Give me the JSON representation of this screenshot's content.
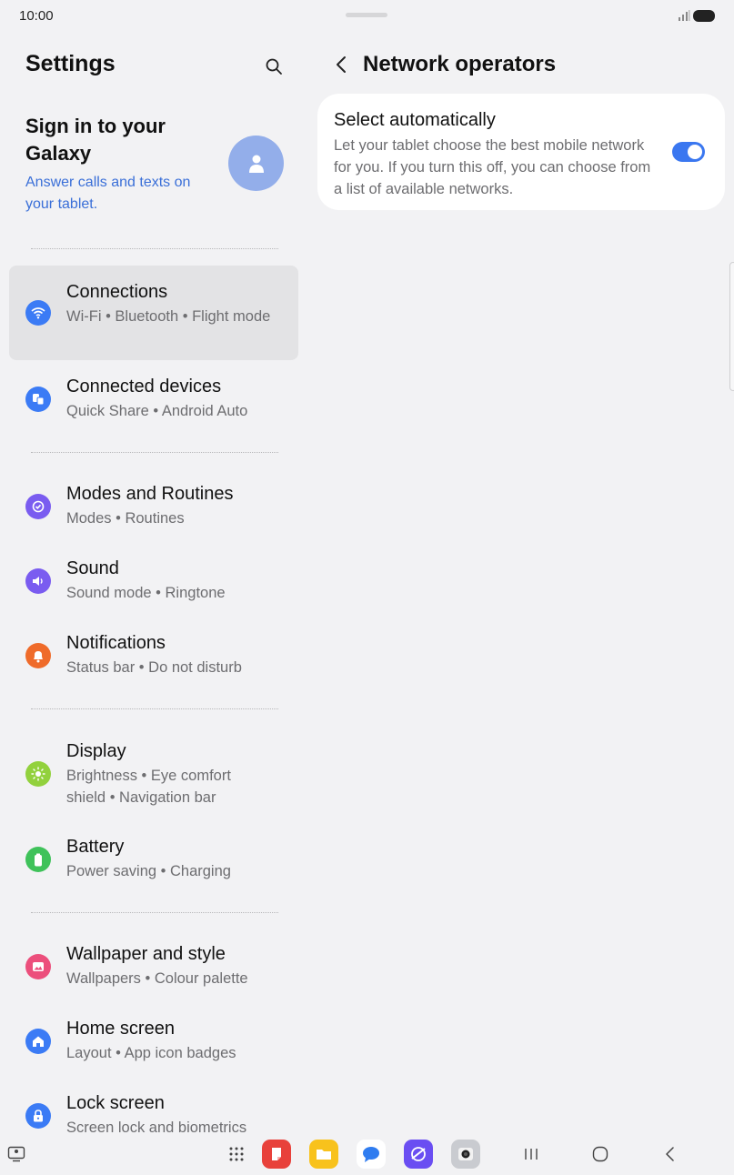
{
  "status_bar": {
    "time": "10:00",
    "icons": [
      "signal-icon",
      "battery-icon"
    ]
  },
  "settings": {
    "title": "Settings",
    "signin": {
      "title": "Sign in to your Galaxy",
      "subtitle": "Answer calls and texts on your tablet."
    },
    "items": [
      {
        "title": "Connections",
        "subtitle": "Wi-Fi  •  Bluetooth  •  Flight mode",
        "icon": "wifi-icon",
        "color": "#3b7bf5",
        "active": true
      },
      {
        "title": "Connected devices",
        "subtitle": "Quick Share  •  Android Auto",
        "icon": "devices-icon",
        "color": "#3b7bf5"
      },
      {
        "title": "Modes and Routines",
        "subtitle": "Modes  •  Routines",
        "icon": "routines-icon",
        "color": "#7a5cf0"
      },
      {
        "title": "Sound",
        "subtitle": "Sound mode  •  Ringtone",
        "icon": "volume-icon",
        "color": "#7a5cf0"
      },
      {
        "title": "Notifications",
        "subtitle": "Status bar  •  Do not disturb",
        "icon": "bell-icon",
        "color": "#ef6b2a"
      },
      {
        "title": "Display",
        "subtitle": "Brightness  •  Eye comfort shield  •  Navigation bar",
        "icon": "sun-icon",
        "color": "#92d13d"
      },
      {
        "title": "Battery",
        "subtitle": "Power saving  •  Charging",
        "icon": "battery-setting-icon",
        "color": "#3fc25a"
      },
      {
        "title": "Wallpaper and style",
        "subtitle": "Wallpapers  •  Colour palette",
        "icon": "wallpaper-icon",
        "color": "#ec4f7c"
      },
      {
        "title": "Home screen",
        "subtitle": "Layout  •  App icon badges",
        "icon": "home-icon",
        "color": "#3b7bf5"
      },
      {
        "title": "Lock screen",
        "subtitle": "Screen lock and biometrics",
        "icon": "lock-icon",
        "color": "#3b7bf5"
      }
    ]
  },
  "network": {
    "title": "Network operators",
    "option": {
      "title": "Select automatically",
      "description": "Let your tablet choose the best mobile network for you. If you turn this off, you can choose from a list of available networks.",
      "enabled": true
    }
  },
  "colors": {
    "accent": "#3a77f0",
    "link": "#3a6fd8",
    "background": "#f2f2f4"
  },
  "nav_bar": {
    "icons": [
      "taskbar-icon",
      "app-drawer-icon",
      "notes-app-icon",
      "files-app-icon",
      "messages-app-icon",
      "internet-app-icon",
      "camera-app-icon",
      "recents-icon",
      "home-nav-icon",
      "back-nav-icon"
    ]
  }
}
